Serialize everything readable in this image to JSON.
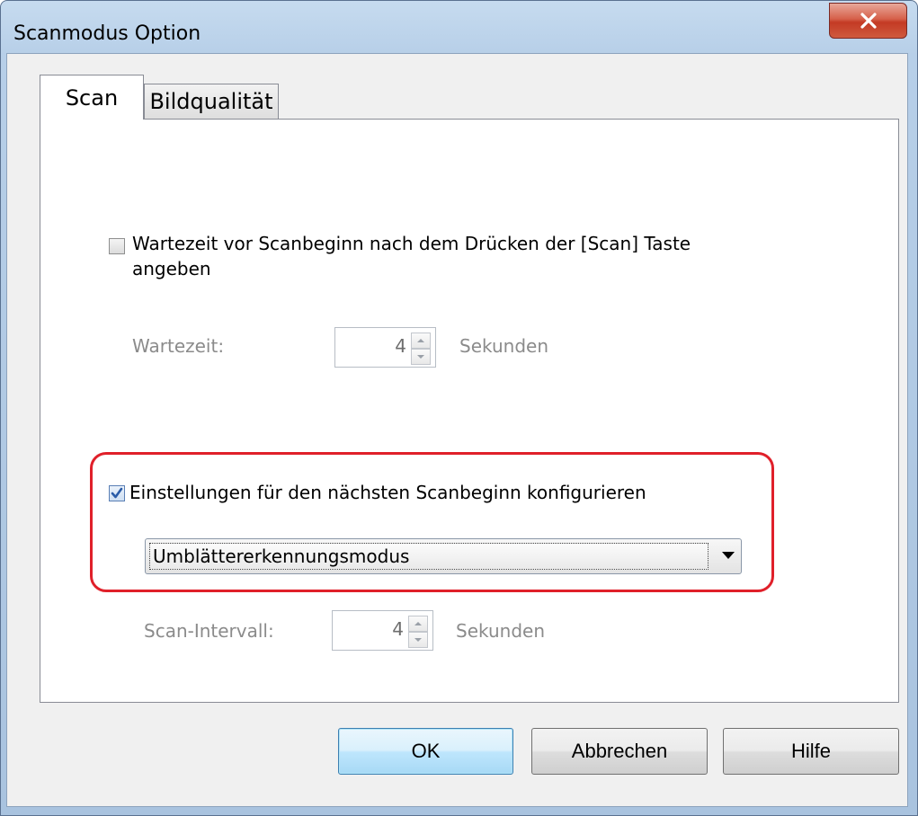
{
  "window": {
    "title": "Scanmodus Option",
    "close_label": "X"
  },
  "tabs": [
    {
      "label": "Scan",
      "active": true
    },
    {
      "label": "Bildqualität",
      "active": false
    }
  ],
  "scan_tab": {
    "wait_checkbox": {
      "label_line1": "Wartezeit vor Scanbeginn nach dem Drücken der [Scan] Taste",
      "label_line2": "angeben",
      "checked": false
    },
    "wait_time": {
      "label": "Wartezeit:",
      "value": "4",
      "unit": "Sekunden",
      "enabled": false
    },
    "next_scan_checkbox": {
      "label": "Einstellungen für den nächsten Scanbeginn konfigurieren",
      "checked": true
    },
    "mode_select": {
      "selected": "Umblättererkennungsmodus"
    },
    "scan_interval": {
      "label": "Scan-Intervall:",
      "value": "4",
      "unit": "Sekunden",
      "enabled": false
    }
  },
  "buttons": {
    "ok": "OK",
    "cancel": "Abbrechen",
    "help": "Hilfe"
  },
  "colors": {
    "highlight": "#e0202a",
    "checkmark": "#2b5ca8",
    "default_button": "#3c7fb1"
  }
}
